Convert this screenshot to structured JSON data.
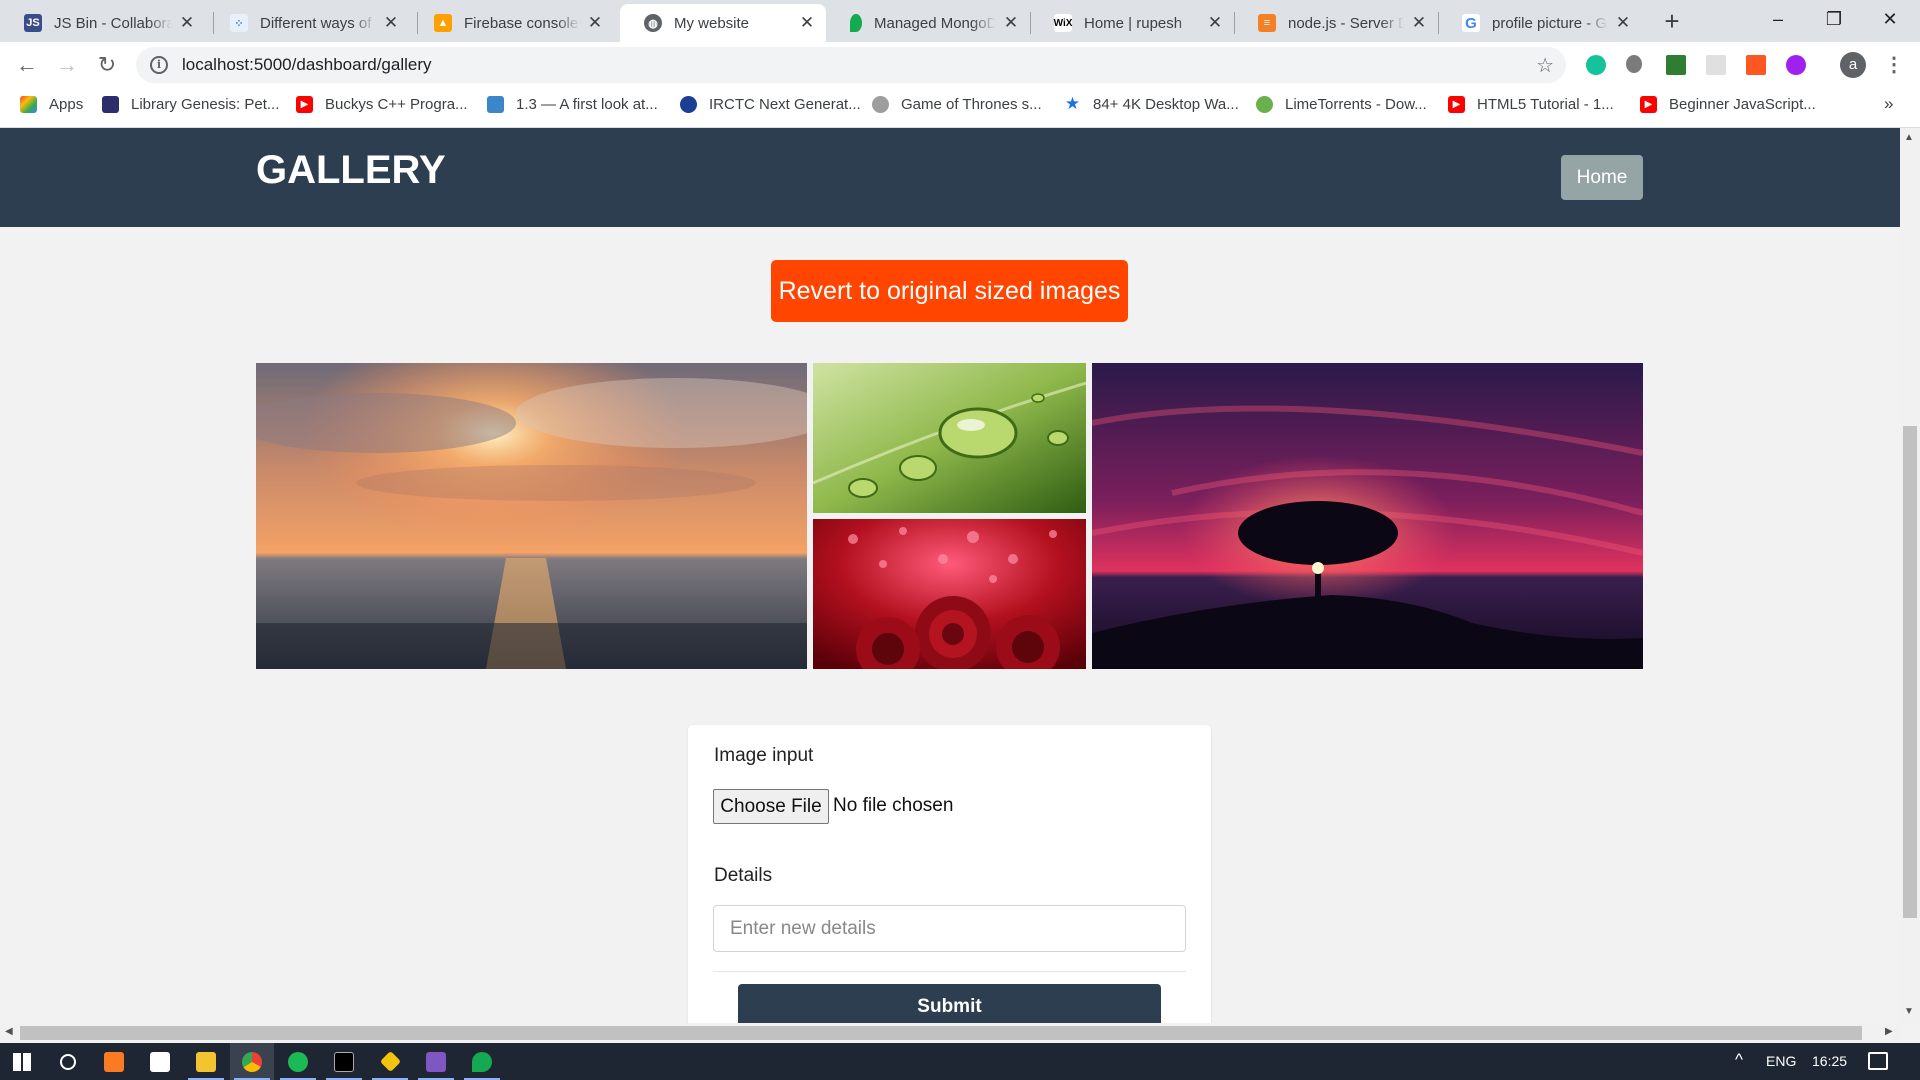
{
  "browser": {
    "tabs": [
      {
        "title": "JS Bin - Collaborative JavaScript Debugging",
        "icon": "jsbin-icon",
        "color": "#3b4c8a",
        "active": false
      },
      {
        "title": "Different ways of calling",
        "icon": "dots-icon",
        "color": "#4285f4",
        "active": false
      },
      {
        "title": "Firebase console",
        "icon": "firebase-icon",
        "color": "#ffa000",
        "active": false
      },
      {
        "title": "My website",
        "icon": "globe-icon",
        "color": "#5f6368",
        "active": true
      },
      {
        "title": "Managed MongoDB Hosting",
        "icon": "mongodb-leaf-icon",
        "color": "#13aa52",
        "active": false
      },
      {
        "title": "Home | rupesh",
        "icon": "wix-icon",
        "color": "#000000",
        "active": false
      },
      {
        "title": "node.js - Server Down",
        "icon": "stackoverflow-icon",
        "color": "#f48024",
        "active": false
      },
      {
        "title": "profile picture - Google Search",
        "icon": "google-icon",
        "color": "#4285f4",
        "active": false
      }
    ],
    "url": "localhost:5000/dashboard/gallery",
    "bookmarks": [
      {
        "label": "Apps",
        "icon": "apps-grid-icon",
        "color": "#e94235"
      },
      {
        "label": "Library Genesis: Pet...",
        "icon": "libgen-icon",
        "color": "#2d2d6e"
      },
      {
        "label": "Buckys C++ Progra...",
        "icon": "youtube-icon",
        "color": "#ff0000"
      },
      {
        "label": "1.3 — A first look at...",
        "icon": "learncpp-icon",
        "color": "#3a86c8"
      },
      {
        "label": "IRCTC Next Generat...",
        "icon": "irctc-icon",
        "color": "#1c3f94"
      },
      {
        "label": "Game of Thrones s...",
        "icon": "globe-grey-icon",
        "color": "#9e9e9e"
      },
      {
        "label": "84+ 4K Desktop Wa...",
        "icon": "star-icon",
        "color": "#1a73e8"
      },
      {
        "label": "LimeTorrents - Dow...",
        "icon": "lime-icon",
        "color": "#6ab04c"
      },
      {
        "label": "HTML5 Tutorial - 1...",
        "icon": "youtube-icon",
        "color": "#ff0000"
      },
      {
        "label": "Beginner JavaScript...",
        "icon": "youtube-icon",
        "color": "#ff0000"
      }
    ],
    "profile_initial": "a"
  },
  "page": {
    "brand": "GALLERY",
    "nav_home": "Home",
    "revert_button": "Revert to original sized images",
    "images": [
      {
        "name": "sunset-sea-image",
        "subject": "ocean sunset"
      },
      {
        "name": "water-drops-leaf-image",
        "subject": "water drops on green leaf"
      },
      {
        "name": "red-roses-hearts-image",
        "subject": "red roses with hearts"
      },
      {
        "name": "lone-tree-sunset-image",
        "subject": "lone tree at sunset"
      }
    ],
    "form": {
      "image_label": "Image input",
      "file_button": "Choose File",
      "file_status": "No file chosen",
      "details_label": "Details",
      "details_placeholder": "Enter new details",
      "submit": "Submit"
    }
  },
  "colors": {
    "navbar": "#2c3e50",
    "revert_button": "#ff4500",
    "home_button": "#95a5a6",
    "submit_button": "#2c3e50"
  },
  "taskbar": {
    "language": "ENG",
    "time": "16:25"
  }
}
